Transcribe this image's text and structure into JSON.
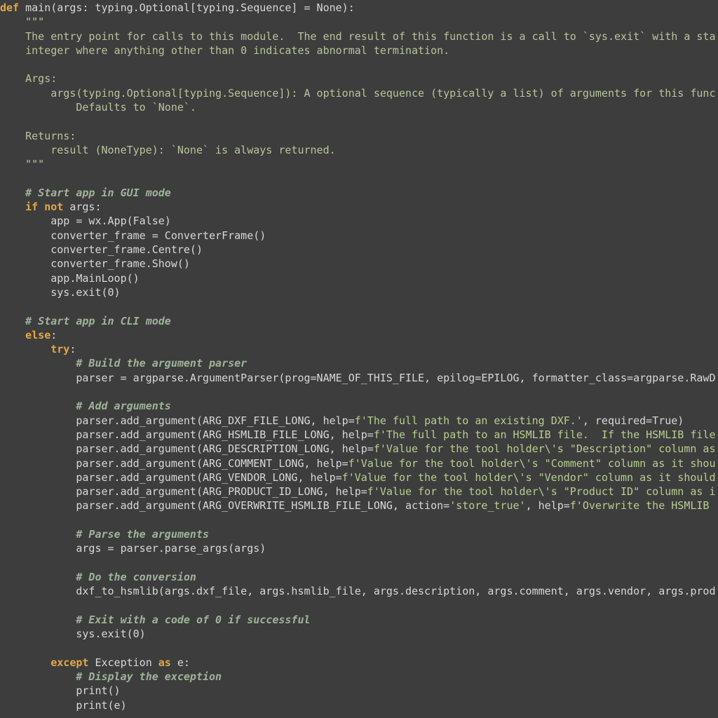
{
  "editor": {
    "language": "python",
    "colors": {
      "background": "#3d3d3d",
      "keyword": "#e3a74a",
      "docstring": "#b7c59a",
      "comment": "#9fb49a",
      "string": "#b7cf8f",
      "text": "#d8d8d8"
    },
    "lines": [
      [
        {
          "t": "kw",
          "v": "def"
        },
        {
          "t": "plain",
          "v": " main(args: typing.Optional[typing.Sequence] = None):"
        }
      ],
      [
        {
          "t": "doc",
          "v": "    \"\"\""
        }
      ],
      [
        {
          "t": "doc",
          "v": "    The entry point for calls to this module.  The end result of this function is a call to `sys.exit` with a sta"
        }
      ],
      [
        {
          "t": "doc",
          "v": "    integer where anything other than 0 indicates abnormal termination."
        }
      ],
      [
        {
          "t": "doc",
          "v": ""
        }
      ],
      [
        {
          "t": "doc",
          "v": "    Args:"
        }
      ],
      [
        {
          "t": "doc",
          "v": "        args(typing.Optional[typing.Sequence]): A optional sequence (typically a list) of arguments for this func"
        }
      ],
      [
        {
          "t": "doc",
          "v": "            Defaults to `None`."
        }
      ],
      [
        {
          "t": "doc",
          "v": ""
        }
      ],
      [
        {
          "t": "doc",
          "v": "    Returns:"
        }
      ],
      [
        {
          "t": "doc",
          "v": "        result (NoneType): `None` is always returned."
        }
      ],
      [
        {
          "t": "doc",
          "v": "    \"\"\""
        }
      ],
      [
        {
          "t": "plain",
          "v": ""
        }
      ],
      [
        {
          "t": "plain",
          "v": "    "
        },
        {
          "t": "cm",
          "v": "# Start app in GUI mode"
        }
      ],
      [
        {
          "t": "plain",
          "v": "    "
        },
        {
          "t": "kw",
          "v": "if not"
        },
        {
          "t": "plain",
          "v": " args:"
        }
      ],
      [
        {
          "t": "plain",
          "v": "        app = wx.App(False)"
        }
      ],
      [
        {
          "t": "plain",
          "v": "        converter_frame = ConverterFrame()"
        }
      ],
      [
        {
          "t": "plain",
          "v": "        converter_frame.Centre()"
        }
      ],
      [
        {
          "t": "plain",
          "v": "        converter_frame.Show()"
        }
      ],
      [
        {
          "t": "plain",
          "v": "        app.MainLoop()"
        }
      ],
      [
        {
          "t": "plain",
          "v": "        sys.exit(0)"
        }
      ],
      [
        {
          "t": "plain",
          "v": ""
        }
      ],
      [
        {
          "t": "plain",
          "v": "    "
        },
        {
          "t": "cm",
          "v": "# Start app in CLI mode"
        }
      ],
      [
        {
          "t": "plain",
          "v": "    "
        },
        {
          "t": "kw",
          "v": "else"
        },
        {
          "t": "plain",
          "v": ":"
        }
      ],
      [
        {
          "t": "plain",
          "v": "        "
        },
        {
          "t": "kw",
          "v": "try"
        },
        {
          "t": "plain",
          "v": ":"
        }
      ],
      [
        {
          "t": "plain",
          "v": "            "
        },
        {
          "t": "cm",
          "v": "# Build the argument parser"
        }
      ],
      [
        {
          "t": "plain",
          "v": "            parser = argparse.ArgumentParser(prog=NAME_OF_THIS_FILE, epilog=EPILOG, formatter_class=argparse.RawD"
        }
      ],
      [
        {
          "t": "plain",
          "v": ""
        }
      ],
      [
        {
          "t": "plain",
          "v": "            "
        },
        {
          "t": "cm",
          "v": "# Add arguments"
        }
      ],
      [
        {
          "t": "plain",
          "v": "            parser.add_argument(ARG_DXF_FILE_LONG, help="
        },
        {
          "t": "str",
          "v": "f'The full path to an existing DXF.'"
        },
        {
          "t": "plain",
          "v": ", required=True)"
        }
      ],
      [
        {
          "t": "plain",
          "v": "            parser.add_argument(ARG_HSMLIB_FILE_LONG, help="
        },
        {
          "t": "str",
          "v": "f'The full path to an HSMLIB file.  If the HSMLIB file"
        }
      ],
      [
        {
          "t": "plain",
          "v": "            parser.add_argument(ARG_DESCRIPTION_LONG, help="
        },
        {
          "t": "str",
          "v": "f'Value for the tool holder\\'s \"Description\" column as"
        }
      ],
      [
        {
          "t": "plain",
          "v": "            parser.add_argument(ARG_COMMENT_LONG, help="
        },
        {
          "t": "str",
          "v": "f'Value for the tool holder\\'s \"Comment\" column as it shou"
        }
      ],
      [
        {
          "t": "plain",
          "v": "            parser.add_argument(ARG_VENDOR_LONG, help="
        },
        {
          "t": "str",
          "v": "f'Value for the tool holder\\'s \"Vendor\" column as it should"
        }
      ],
      [
        {
          "t": "plain",
          "v": "            parser.add_argument(ARG_PRODUCT_ID_LONG, help="
        },
        {
          "t": "str",
          "v": "f'Value for the tool holder\\'s \"Product ID\" column as i"
        }
      ],
      [
        {
          "t": "plain",
          "v": "            parser.add_argument(ARG_OVERWRITE_HSMLIB_FILE_LONG, action="
        },
        {
          "t": "str",
          "v": "'store_true'"
        },
        {
          "t": "plain",
          "v": ", help="
        },
        {
          "t": "str",
          "v": "f'Overwrite the HSMLIB "
        }
      ],
      [
        {
          "t": "plain",
          "v": ""
        }
      ],
      [
        {
          "t": "plain",
          "v": "            "
        },
        {
          "t": "cm",
          "v": "# Parse the arguments"
        }
      ],
      [
        {
          "t": "plain",
          "v": "            args = parser.parse_args(args)"
        }
      ],
      [
        {
          "t": "plain",
          "v": ""
        }
      ],
      [
        {
          "t": "plain",
          "v": "            "
        },
        {
          "t": "cm",
          "v": "# Do the conversion"
        }
      ],
      [
        {
          "t": "plain",
          "v": "            dxf_to_hsmlib(args.dxf_file, args.hsmlib_file, args.description, args.comment, args.vendor, args.prod"
        }
      ],
      [
        {
          "t": "plain",
          "v": ""
        }
      ],
      [
        {
          "t": "plain",
          "v": "            "
        },
        {
          "t": "cm",
          "v": "# Exit with a code of 0 if successful"
        }
      ],
      [
        {
          "t": "plain",
          "v": "            sys.exit(0)"
        }
      ],
      [
        {
          "t": "plain",
          "v": ""
        }
      ],
      [
        {
          "t": "plain",
          "v": "        "
        },
        {
          "t": "kw",
          "v": "except"
        },
        {
          "t": "plain",
          "v": " Exception "
        },
        {
          "t": "kw",
          "v": "as"
        },
        {
          "t": "plain",
          "v": " e:"
        }
      ],
      [
        {
          "t": "plain",
          "v": "            "
        },
        {
          "t": "cm",
          "v": "# Display the exception"
        }
      ],
      [
        {
          "t": "plain",
          "v": "            print()"
        }
      ],
      [
        {
          "t": "plain",
          "v": "            print(e)"
        }
      ]
    ]
  }
}
